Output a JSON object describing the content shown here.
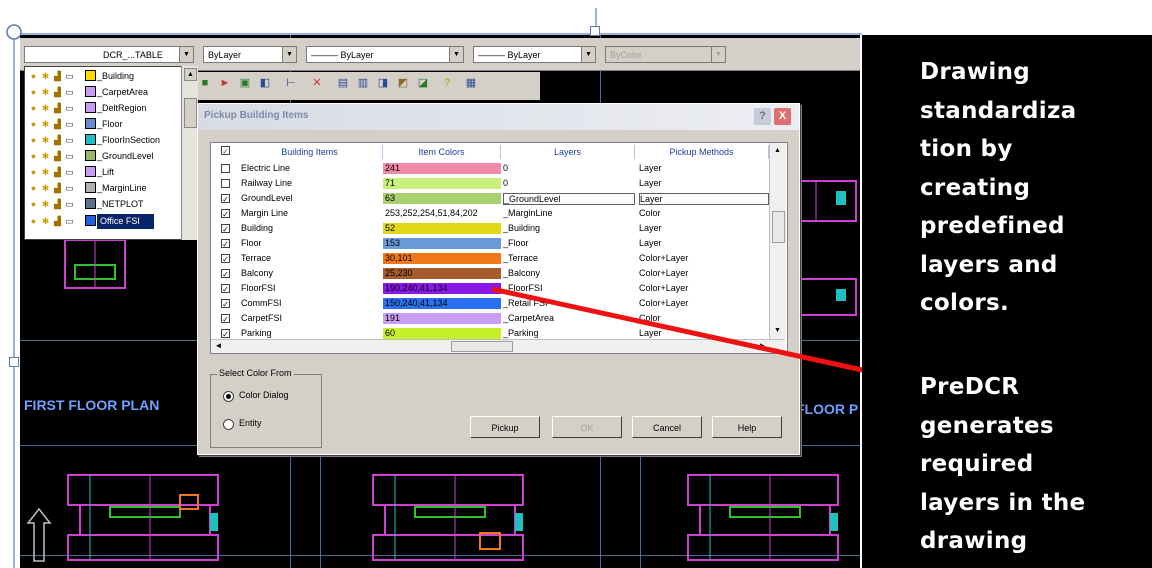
{
  "annotation": {
    "lines_top": [
      "Drawing",
      "standardiza",
      "tion by",
      "creating",
      "predefined",
      "layers and",
      "colors."
    ],
    "lines_bottom": [
      "PreDCR",
      "generates",
      "required",
      "layers in the",
      "drawing"
    ]
  },
  "toolbar": {
    "layer_combo": "DCR_...TABLE",
    "color_combo": "ByLayer",
    "linetype_combo": "——— ByLayer",
    "lineweight_combo": "——— ByLayer",
    "plotstyle_combo": "ByColor"
  },
  "layer_list": [
    {
      "name": "_Building",
      "color": "#ffd800"
    },
    {
      "name": "_CarpetArea",
      "color": "#c89cf0"
    },
    {
      "name": "_DeltRegion",
      "color": "#c89cf0"
    },
    {
      "name": "_Floor",
      "color": "#6b8ccc"
    },
    {
      "name": "_FloorInSection",
      "color": "#20c0c0"
    },
    {
      "name": "_GroundLevel",
      "color": "#9ab86a"
    },
    {
      "name": "_Lift",
      "color": "#c89cf0"
    },
    {
      "name": "_MarginLine",
      "color": "#b0b0b0"
    },
    {
      "name": "_NETPLOT",
      "color": "#5a7090"
    },
    {
      "name": "Office FSI",
      "color": "#2060e0"
    }
  ],
  "canvas": {
    "label_first_floor": "FIRST FLOOR PLAN",
    "label_right_floor": "FLOOR P"
  },
  "dialog": {
    "title": "Pickup Building Items",
    "help_glyph": "?",
    "close_glyph": "X",
    "headers": [
      "Building Items",
      "Item Colors",
      "Layers",
      "Pickup Methods"
    ],
    "rows": [
      {
        "checked": false,
        "item": "Electric Line",
        "color_value": "241",
        "color_hex": "#f08aa8",
        "layer": "0",
        "method": "Layer"
      },
      {
        "checked": false,
        "item": "Railway Line",
        "color_value": "71",
        "color_hex": "#c8f07a",
        "layer": "0",
        "method": "Layer"
      },
      {
        "checked": true,
        "item": "GroundLevel",
        "color_value": "63",
        "color_hex": "#a8d070",
        "layer": "_GroundLevel",
        "method": "Layer"
      },
      {
        "checked": true,
        "item": "Margin Line",
        "color_value": "253,252,254,51,84,202",
        "color_hex": "#ffffff",
        "layer": "_MarginLine",
        "method": "Color"
      },
      {
        "checked": true,
        "item": "Building",
        "color_value": "52",
        "color_hex": "#e0d818",
        "layer": "_Building",
        "method": "Layer"
      },
      {
        "checked": true,
        "item": "Floor",
        "color_value": "153",
        "color_hex": "#6a9ad8",
        "layer": "_Floor",
        "method": "Layer"
      },
      {
        "checked": true,
        "item": "Terrace",
        "color_value": "30,101",
        "color_hex": "#f07818",
        "layer": "_Terrace",
        "method": "Color+Layer"
      },
      {
        "checked": true,
        "item": "Balcony",
        "color_value": "25,230",
        "color_hex": "#a85a2a",
        "layer": "_Balcony",
        "method": "Color+Layer"
      },
      {
        "checked": true,
        "item": "FloorFSI",
        "color_value": "190,240,41,134",
        "color_hex": "#8a18e8",
        "layer": "_FloorFSI",
        "method": "Color+Layer"
      },
      {
        "checked": true,
        "item": "CommFSI",
        "color_value": "150,240,41,134",
        "color_hex": "#2a70f0",
        "layer": "_Retail FSI",
        "method": "Color+Layer"
      },
      {
        "checked": true,
        "item": "CarpetFSI",
        "color_value": "191",
        "color_hex": "#c89cf0",
        "layer": "_CarpetArea",
        "method": "Color"
      },
      {
        "checked": true,
        "item": "Parking",
        "color_value": "60",
        "color_hex": "#c8f028",
        "layer": "_Parking",
        "method": "Layer"
      }
    ],
    "group_label": "Select Color From",
    "radio_color_dialog": "Color Dialog",
    "radio_entity": "Entity",
    "btn_pickup": "Pickup",
    "btn_ok": "OK",
    "btn_cancel": "Cancel",
    "btn_help": "Help"
  },
  "colors": {
    "arrow": "#ee1111",
    "cad_line": "#4a6a9a",
    "plan_magenta": "#d040d0",
    "plan_cyan": "#20c0c0",
    "plan_orange": "#f07818",
    "plan_green": "#30c030"
  }
}
